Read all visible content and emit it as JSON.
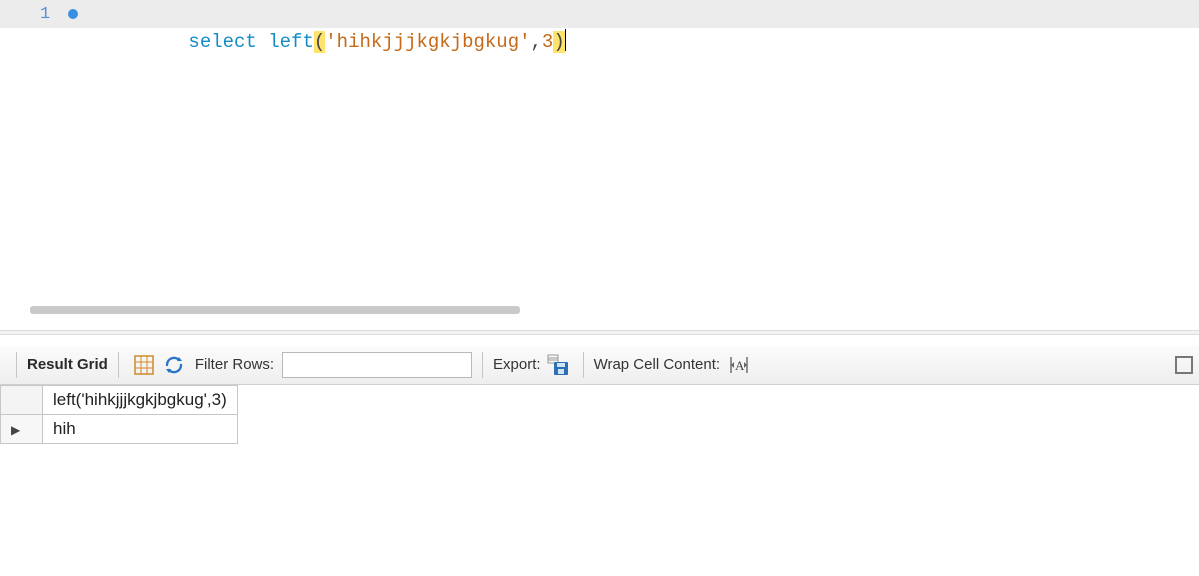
{
  "editor": {
    "line_number": "1",
    "tokens": {
      "kw_select": "select ",
      "fn_left": "left",
      "paren_open": "(",
      "string_lit": "'hihkjjjkgkjbgkug'",
      "comma": ",",
      "num_arg": "3",
      "paren_close": ")"
    }
  },
  "toolbar": {
    "result_grid": "Result Grid",
    "filter_label": "Filter Rows:",
    "filter_value": "",
    "export_label": "Export:",
    "wrap_label": "Wrap Cell Content:"
  },
  "results": {
    "column_header": "left('hihkjjjkgkjbgkug',3)",
    "row_marker": "▶",
    "rows": [
      {
        "value": "hih"
      }
    ]
  }
}
